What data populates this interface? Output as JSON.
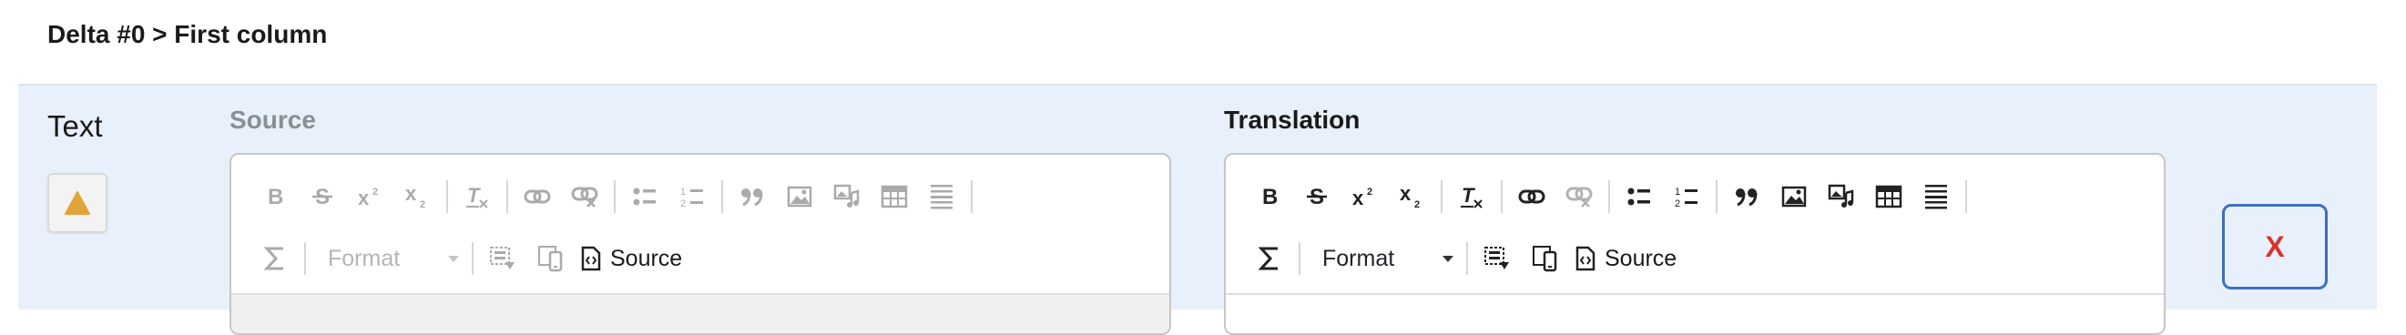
{
  "breadcrumb": "Delta #0 > First column",
  "field": {
    "label": "Text",
    "warning_icon": "warning-triangle-icon",
    "warning_color": "#e0a43a"
  },
  "source": {
    "label": "Source",
    "format_label": "Format",
    "source_button_label": "Source",
    "state": "read-only"
  },
  "translation": {
    "label": "Translation",
    "format_label": "Format",
    "source_button_label": "Source"
  },
  "remove_button": {
    "label": "X",
    "color": "#d9342b",
    "border_color": "#3d6fc4"
  },
  "toolbar_icons": [
    "bold-icon",
    "strikethrough-icon",
    "superscript-icon",
    "subscript-icon",
    "remove-format-icon",
    "link-icon",
    "unlink-icon",
    "bulleted-list-icon",
    "numbered-list-icon",
    "blockquote-icon",
    "image-icon",
    "media-icon",
    "table-icon",
    "horizontal-rule-icon",
    "sigma-icon",
    "show-blocks-icon",
    "mobile-preview-icon",
    "source-icon"
  ],
  "colors": {
    "panel_bg": "#e8f0fb",
    "disabled_text": "#8a8f94"
  }
}
